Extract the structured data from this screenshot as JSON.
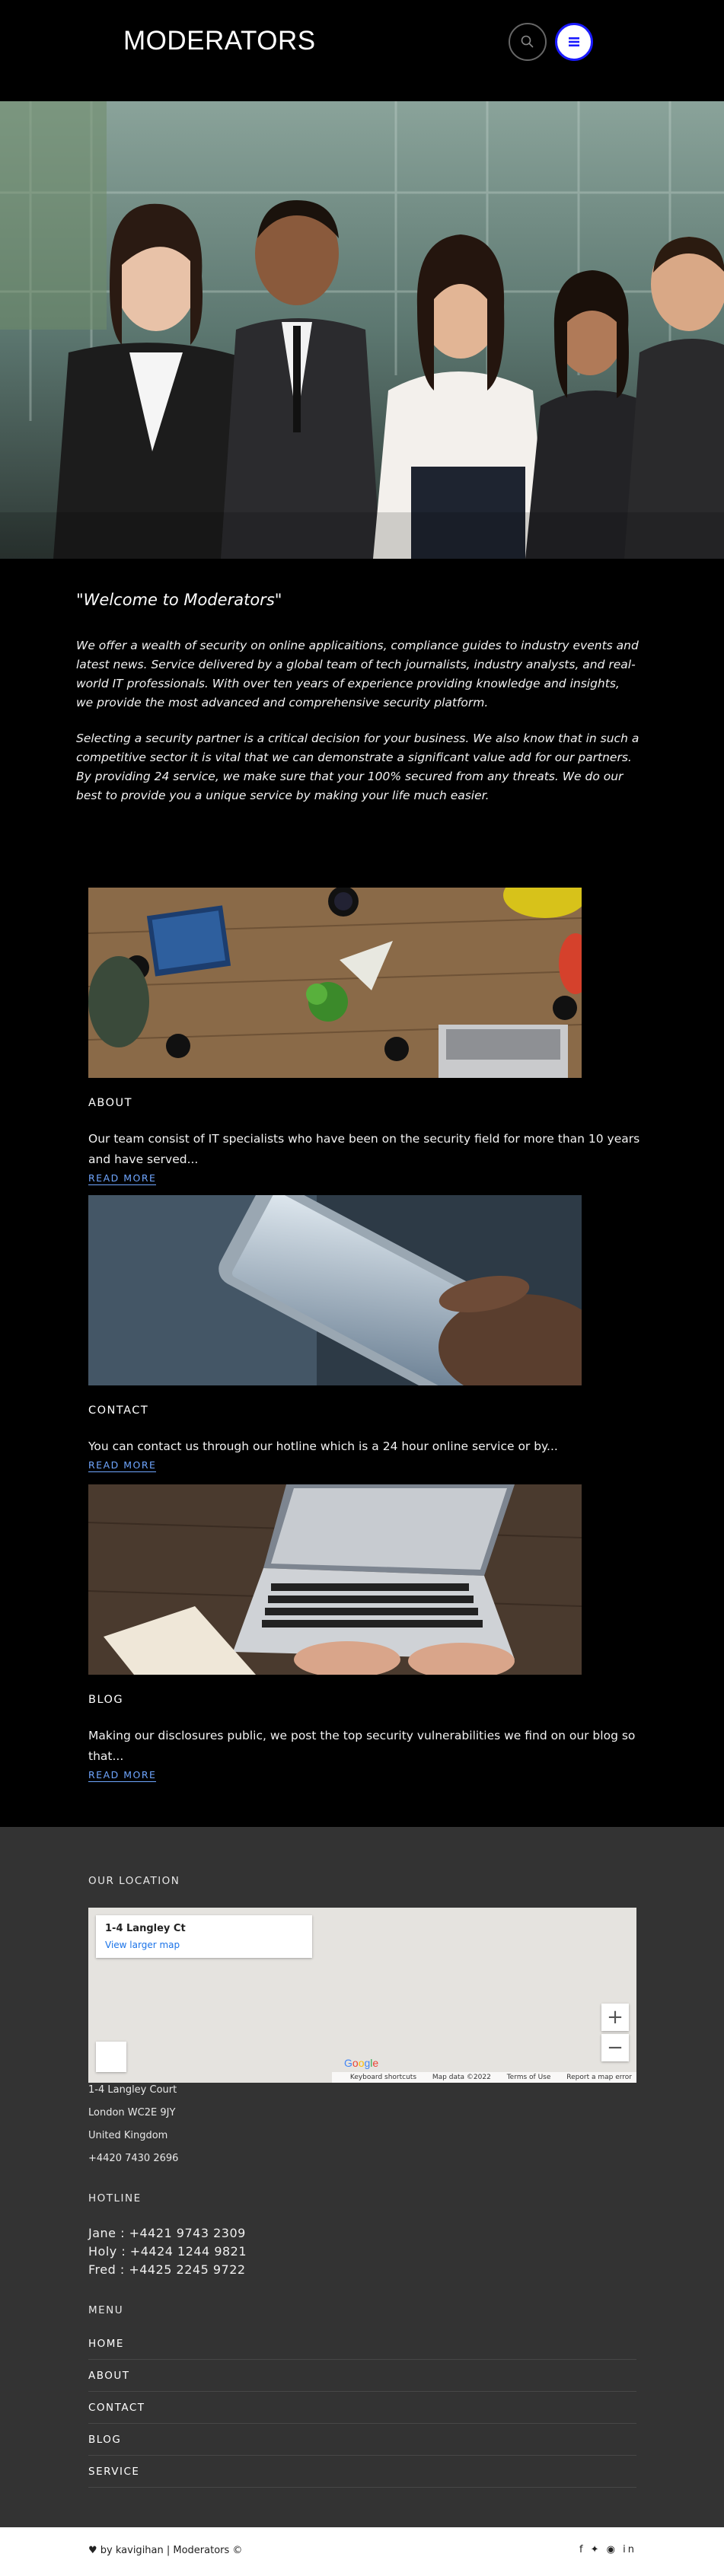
{
  "header": {
    "brand": "MODERATORS",
    "search_icon": "search-icon",
    "menu_icon": "menu-icon"
  },
  "colors": {
    "accent": "#1a1aff",
    "link": "#6fa6ff",
    "footer_bg": "#333333"
  },
  "welcome": {
    "title": "\"Welcome to Moderators\"",
    "para1": "We offer a wealth of security on online applicaitions, compliance guides to industry events and latest news. Service delivered by a global team of tech journalists, industry analysts, and real-world IT professionals. With over ten years of experience providing knowledge and insights, we provide the most advanced and comprehensive security platform.",
    "para2": "Selecting a security partner is a critical decision for your business. We also know that in such a competitive sector it is vital that we can demonstrate a significant value add for our partners. By providing 24 service, we make sure that your 100% secured from any threats. We do our best to provide you a unique service by making your life much easier."
  },
  "cards": [
    {
      "title": "ABOUT",
      "text": "Our team consist of IT specialists who have been on the security field for more than 10 years and have served...",
      "link": "READ MORE"
    },
    {
      "title": "CONTACT",
      "text": "You can contact us through our hotline which is a 24 hour online service or by...",
      "link": "READ MORE"
    },
    {
      "title": "BLOG",
      "text": "Making our disclosures public, we post the top security vulnerabilities we find on our blog so that...",
      "link": "READ MORE"
    }
  ],
  "footer": {
    "location_heading": "OUR LOCATION",
    "map": {
      "place": "1-4 Langley Ct",
      "larger_map": "View larger map",
      "zoom_in": "+",
      "zoom_out": "−",
      "google": "Google",
      "shortcuts": "Keyboard shortcuts",
      "map_data": "Map data ©2022",
      "terms": "Terms of Use",
      "report": "Report a map error"
    },
    "address": [
      "1-4 Langley Court",
      "London WC2E 9JY",
      "United Kingdom",
      "+4420 7430 2696"
    ],
    "hotline_heading": "HOTLINE",
    "hotlines": [
      "Jane : +4421 9743 2309",
      "Holy : +4424 1244 9821",
      "Fred : +4425 2245 9722"
    ],
    "menu_heading": "MENU",
    "menu": [
      "HOME",
      "ABOUT",
      "CONTACT",
      "BLOG",
      "SERVICE"
    ]
  },
  "bottom": {
    "credit": "♥ by kavigihan | Moderators ©",
    "social": "f ✦ ◉ in"
  }
}
